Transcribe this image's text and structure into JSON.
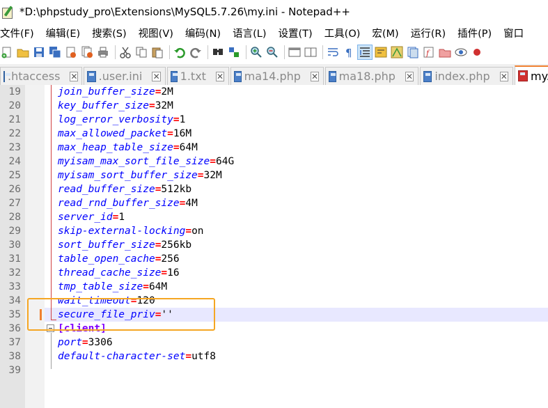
{
  "window": {
    "title": "*D:\\phpstudy_pro\\Extensions\\MySQL5.7.26\\my.ini - Notepad++"
  },
  "menu": [
    "文件(F)",
    "编辑(E)",
    "搜索(S)",
    "视图(V)",
    "编码(N)",
    "语言(L)",
    "设置(T)",
    "工具(O)",
    "宏(M)",
    "运行(R)",
    "插件(P)",
    "窗口"
  ],
  "tabs": [
    {
      "label": ".htaccess"
    },
    {
      "label": ".user.ini"
    },
    {
      "label": "1.txt"
    },
    {
      "label": "ma14.php"
    },
    {
      "label": "ma18.php"
    },
    {
      "label": "index.php"
    },
    {
      "label": "my."
    }
  ],
  "editor": {
    "lines": [
      {
        "n": "19",
        "key": "join_buffer_size",
        "op": "=",
        "val": "2M"
      },
      {
        "n": "20",
        "key": "key_buffer_size",
        "op": "=",
        "val": "32M"
      },
      {
        "n": "21",
        "key": "log_error_verbosity",
        "op": "=",
        "val": "1"
      },
      {
        "n": "22",
        "key": "max_allowed_packet",
        "op": "=",
        "val": "16M"
      },
      {
        "n": "23",
        "key": "max_heap_table_size",
        "op": "=",
        "val": "64M"
      },
      {
        "n": "24",
        "key": "myisam_max_sort_file_size",
        "op": "=",
        "val": "64G"
      },
      {
        "n": "25",
        "key": "myisam_sort_buffer_size",
        "op": "=",
        "val": "32M"
      },
      {
        "n": "26",
        "key": "read_buffer_size",
        "op": "=",
        "val": "512kb"
      },
      {
        "n": "27",
        "key": "read_rnd_buffer_size",
        "op": "=",
        "val": "4M"
      },
      {
        "n": "28",
        "key": "server_id",
        "op": "=",
        "val": "1"
      },
      {
        "n": "29",
        "key": "skip-external-locking",
        "op": "=",
        "val": "on"
      },
      {
        "n": "30",
        "key": "sort_buffer_size",
        "op": "=",
        "val": "256kb"
      },
      {
        "n": "31",
        "key": "table_open_cache",
        "op": "=",
        "val": "256"
      },
      {
        "n": "32",
        "key": "thread_cache_size",
        "op": "=",
        "val": "16"
      },
      {
        "n": "33",
        "key": "tmp_table_size",
        "op": "=",
        "val": "64M"
      },
      {
        "n": "34",
        "key": "wait_timeout",
        "op": "=",
        "val": "120"
      },
      {
        "n": "35",
        "key": "secure_file_priv",
        "op": "=",
        "val": "''"
      },
      {
        "n": "36",
        "section": "[client]"
      },
      {
        "n": "37",
        "key": "port",
        "op": "=",
        "val": "3306"
      },
      {
        "n": "38",
        "key": "default-character-set",
        "op": "=",
        "val": "utf8"
      },
      {
        "n": "39"
      }
    ]
  },
  "colors": {
    "key": "#0000ff",
    "operator": "#ff0000",
    "section": "#8000ff",
    "annotation": "#f5a623",
    "active_tab": "#f08030"
  }
}
